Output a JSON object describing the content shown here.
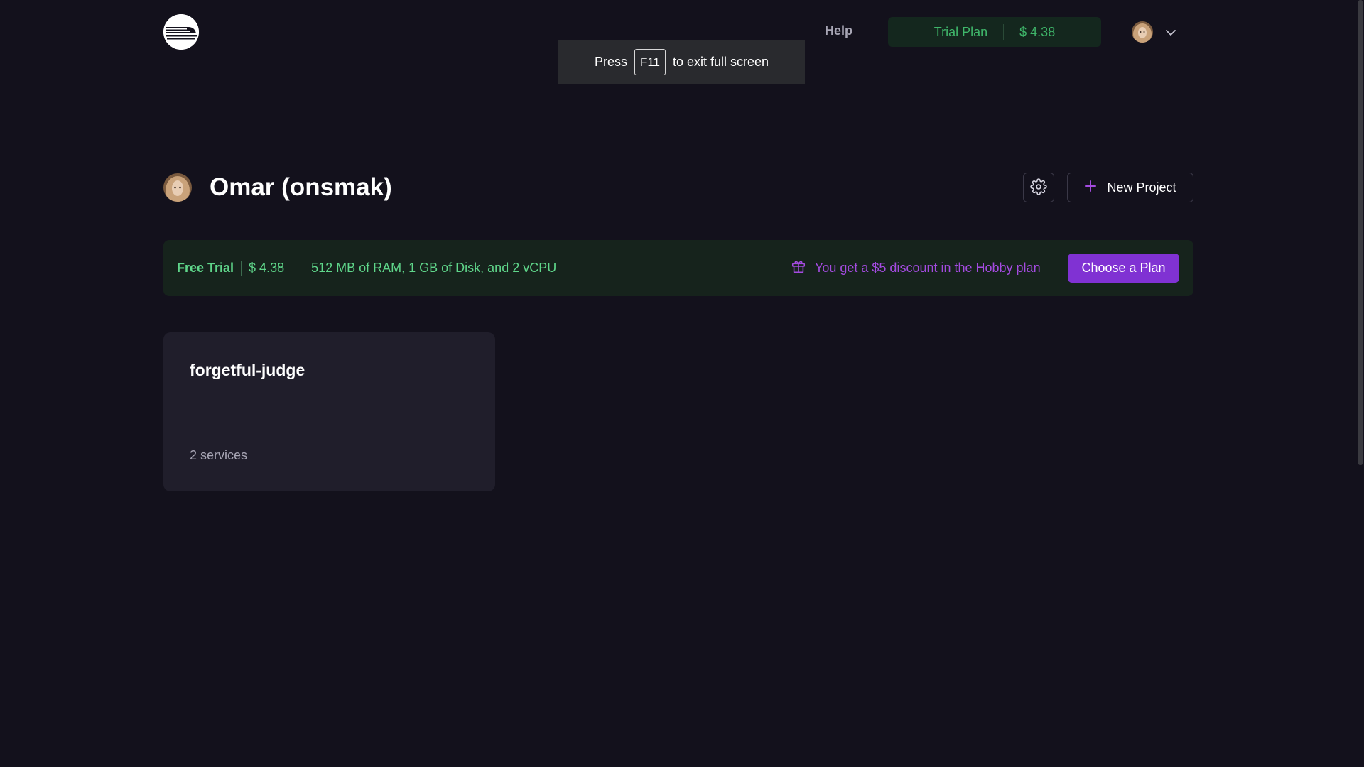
{
  "nav": {
    "help_label": "Help",
    "plan_label": "Trial Plan",
    "plan_amount": "$ 4.38"
  },
  "fullscreen_toast": {
    "press": "Press",
    "key": "F11",
    "suffix": "to exit full screen"
  },
  "header": {
    "title": "Omar (onsmak)",
    "new_project_label": "New Project"
  },
  "plan_banner": {
    "plan_name": "Free Trial",
    "amount": "$ 4.38",
    "specs": "512 MB of RAM, 1 GB of Disk, and 2 vCPU",
    "discount_text": "You get a $5 discount in the Hobby plan",
    "choose_plan_label": "Choose a Plan"
  },
  "projects": [
    {
      "name": "forgetful-judge",
      "services": "2 services"
    }
  ],
  "icons": {
    "logo": "railway-logo-icon",
    "settings": "gear-icon",
    "new_project": "plus-icon",
    "discount": "gift-icon",
    "user_menu": "chevron-down-icon"
  },
  "colors": {
    "background": "#13111c",
    "card": "#201e2b",
    "accent_purple": "#8032d3",
    "success_green": "#5fd68a",
    "banner_bg": "#16231c"
  }
}
